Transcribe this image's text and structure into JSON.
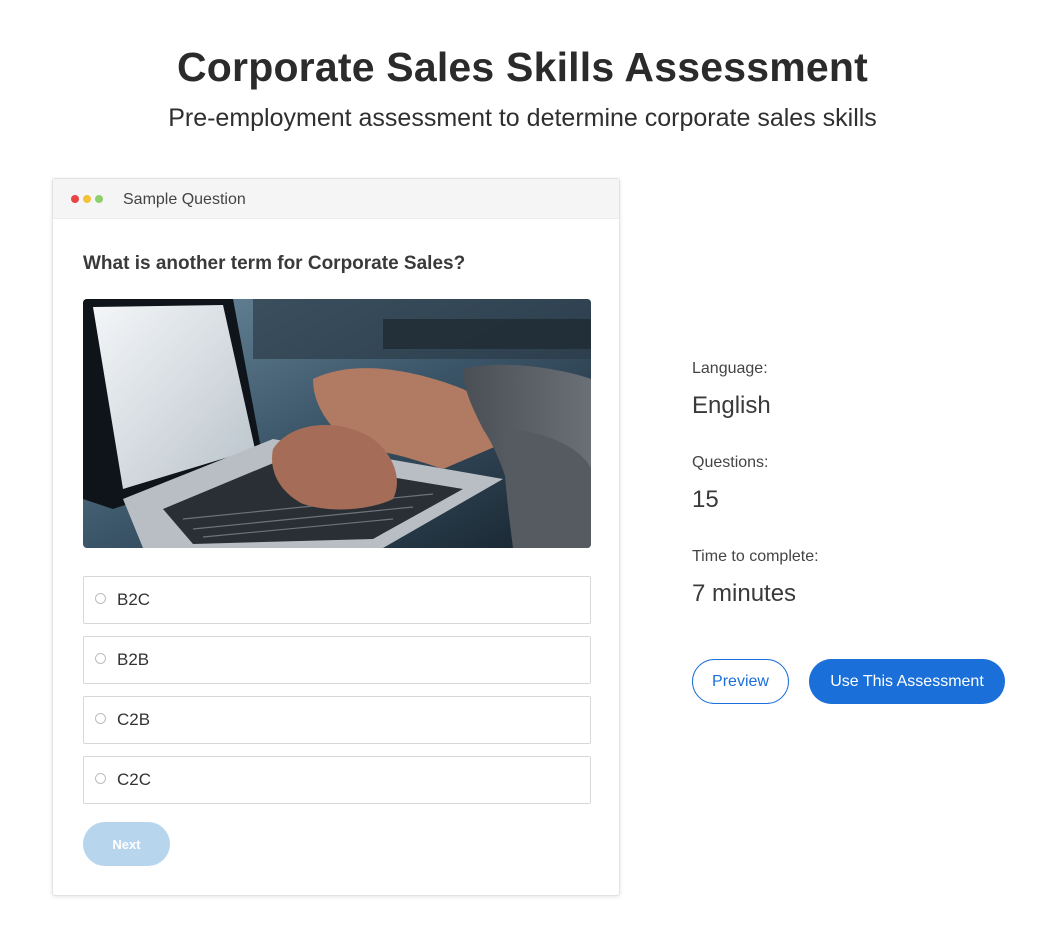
{
  "header": {
    "title": "Corporate Sales Skills Assessment",
    "subtitle": "Pre-employment assessment to determine corporate sales skills"
  },
  "sample_card": {
    "header_title": "Sample Question",
    "window_dot_colors": [
      "#e84545",
      "#f3c237",
      "#8dd06b"
    ],
    "question": "What is another term for Corporate Sales?",
    "image": "laptop-typing-photo",
    "options": [
      {
        "label": "B2C",
        "selected": false
      },
      {
        "label": "B2B",
        "selected": false
      },
      {
        "label": "C2B",
        "selected": false
      },
      {
        "label": "C2C",
        "selected": false
      }
    ],
    "next_label": "Next"
  },
  "details": {
    "language_label": "Language:",
    "language_value": "English",
    "questions_label": "Questions:",
    "questions_value": "15",
    "time_label": "Time to complete:",
    "time_value": "7 minutes"
  },
  "actions": {
    "preview_label": "Preview",
    "use_label": "Use This Assessment"
  },
  "colors": {
    "accent": "#1a6fd9",
    "next_disabled": "#b8d5ee"
  }
}
